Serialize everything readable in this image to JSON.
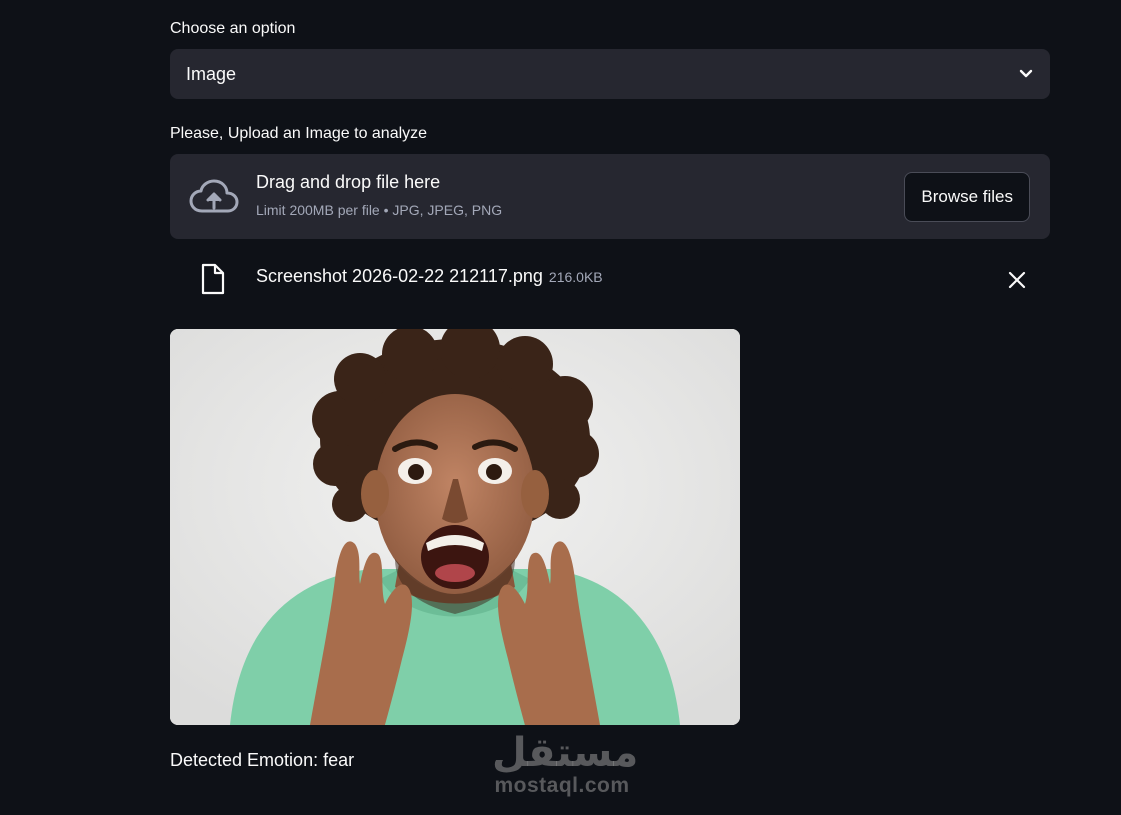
{
  "select": {
    "label": "Choose an option",
    "value": "Image"
  },
  "uploader": {
    "label": "Please, Upload an Image to analyze",
    "title": "Drag and drop file here",
    "subtitle": "Limit 200MB per file • JPG, JPEG, PNG",
    "browse_label": "Browse files"
  },
  "file": {
    "name": "Screenshot 2026-02-22 212117.png",
    "size": "216.0KB"
  },
  "result": {
    "text": "Detected Emotion: fear"
  },
  "watermark": {
    "arabic": "مستقل",
    "latin": "mostaql.com"
  },
  "icons": {
    "chevron": "chevron-down-icon",
    "upload": "cloud-upload-icon",
    "file": "file-icon",
    "close": "close-icon"
  }
}
